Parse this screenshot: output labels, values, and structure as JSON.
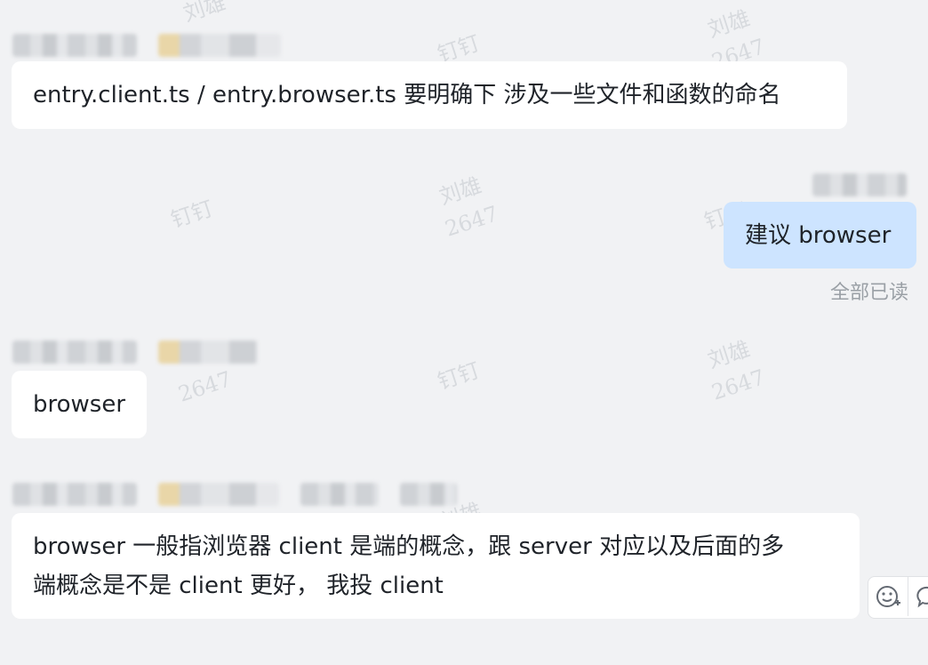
{
  "watermark": {
    "name": "刘雄",
    "id": "2647",
    "app": "钉钉"
  },
  "messages": [
    {
      "text": "entry.client.ts  /  entry.browser.ts 要明确下 涉及一些文件和函数的命名"
    },
    {
      "text": "建议 browser",
      "read_status": "全部已读"
    },
    {
      "text": "browser"
    },
    {
      "line1": "browser 一般指浏览器  client 是端的概念，跟 server 对应以及后面的多",
      "line2": "端概念是不是 client 更好，  我投 client"
    }
  ],
  "icons": {
    "add_reaction": "emoji-add-icon",
    "reply": "reply-icon"
  }
}
